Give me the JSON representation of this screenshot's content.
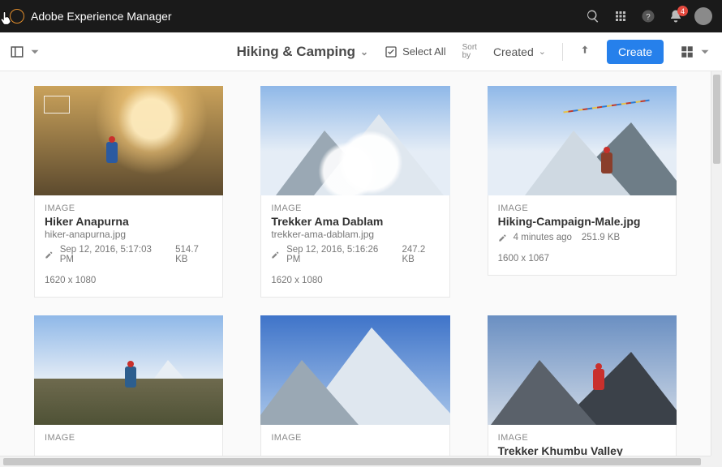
{
  "shell": {
    "product_name": "Adobe Experience Manager",
    "notification_count": "4"
  },
  "toolbar": {
    "breadcrumb_current": "Hiking & Camping",
    "select_all_label": "Select All",
    "sort_by_label_line1": "Sort",
    "sort_by_label_line2": "by",
    "sort_field": "Created",
    "create_label": "Create"
  },
  "assets": [
    {
      "variant": "sun",
      "type_label": "IMAGE",
      "title": "Hiker Anapurna",
      "filename": "hiker-anapurna.jpg",
      "modified": "Sep 12, 2016, 5:17:03 PM",
      "filesize": "514.7 KB",
      "dimensions": "1620 x 1080",
      "show_filename": true,
      "show_dims": true,
      "show_crop": true
    },
    {
      "variant": "cloudpeak",
      "type_label": "IMAGE",
      "title": "Trekker Ama Dablam",
      "filename": "trekker-ama-dablam.jpg",
      "modified": "Sep 12, 2016, 5:16:26 PM",
      "filesize": "247.2 KB",
      "dimensions": "1620 x 1080",
      "show_filename": true,
      "show_dims": true,
      "show_crop": false
    },
    {
      "variant": "flags",
      "type_label": "IMAGE",
      "title": "Hiking-Campaign-Male.jpg",
      "filename": "",
      "modified": "4 minutes ago",
      "filesize": "251.9 KB",
      "dimensions": "1600 x 1067",
      "show_filename": false,
      "show_dims": true,
      "show_crop": false
    },
    {
      "variant": "meadow",
      "type_label": "IMAGE",
      "title": "",
      "filename": "",
      "modified": "",
      "filesize": "",
      "dimensions": "",
      "show_filename": false,
      "show_dims": false,
      "show_crop": false
    },
    {
      "variant": "bigpeak",
      "type_label": "IMAGE",
      "title": "",
      "filename": "",
      "modified": "",
      "filesize": "",
      "dimensions": "",
      "show_filename": false,
      "show_dims": false,
      "show_crop": false
    },
    {
      "variant": "ridge",
      "type_label": "IMAGE",
      "title": "Trekker Khumbu Valley",
      "filename": "",
      "modified": "",
      "filesize": "",
      "dimensions": "",
      "show_filename": false,
      "show_dims": false,
      "show_crop": false
    }
  ]
}
